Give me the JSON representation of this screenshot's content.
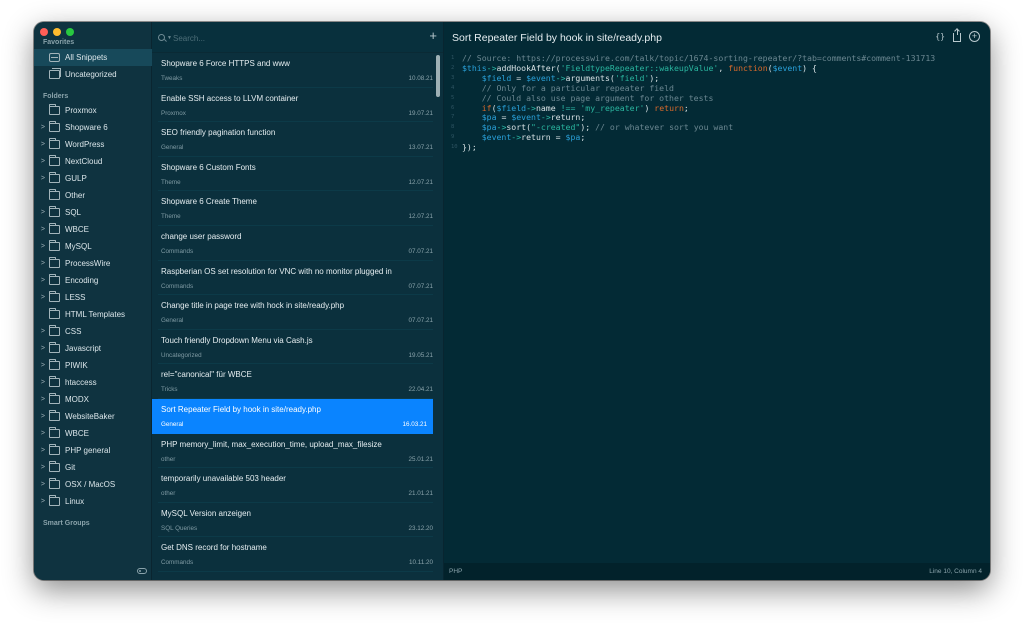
{
  "window": {
    "traffic_lights": [
      "close",
      "minimize",
      "zoom"
    ]
  },
  "sidebar": {
    "favorites_label": "Favorites",
    "favorites": [
      {
        "label": "All Snippets",
        "icon": "tray-icon",
        "selected": true
      },
      {
        "label": "Uncategorized",
        "icon": "stack-icon",
        "selected": false
      }
    ],
    "folders_label": "Folders",
    "folders": [
      {
        "label": "Proxmox",
        "expandable": false
      },
      {
        "label": "Shopware 6",
        "expandable": true
      },
      {
        "label": "WordPress",
        "expandable": true
      },
      {
        "label": "NextCloud",
        "expandable": true
      },
      {
        "label": "GULP",
        "expandable": true
      },
      {
        "label": "Other",
        "expandable": false
      },
      {
        "label": "SQL",
        "expandable": true
      },
      {
        "label": "WBCE",
        "expandable": true
      },
      {
        "label": "MySQL",
        "expandable": true
      },
      {
        "label": "ProcessWire",
        "expandable": true
      },
      {
        "label": "Encoding",
        "expandable": true
      },
      {
        "label": "LESS",
        "expandable": true
      },
      {
        "label": "HTML Templates",
        "expandable": false
      },
      {
        "label": "CSS",
        "expandable": true
      },
      {
        "label": "Javascript",
        "expandable": true
      },
      {
        "label": "PIWIK",
        "expandable": true
      },
      {
        "label": "htaccess",
        "expandable": true
      },
      {
        "label": "MODX",
        "expandable": true
      },
      {
        "label": "WebsiteBaker",
        "expandable": true
      },
      {
        "label": "WBCE",
        "expandable": true
      },
      {
        "label": "PHP general",
        "expandable": true
      },
      {
        "label": "Git",
        "expandable": true
      },
      {
        "label": "OSX / MacOS",
        "expandable": true
      },
      {
        "label": "Linux",
        "expandable": true
      }
    ],
    "smart_groups_label": "Smart Groups",
    "chevron_glyph": ">"
  },
  "list": {
    "search_placeholder": "Search...",
    "search_value": "",
    "add_glyph": "+",
    "items": [
      {
        "title": "Shopware 6 Force HTTPS and www",
        "category": "Tweaks",
        "date": "10.08.21"
      },
      {
        "title": "Enable SSH access to LLVM container",
        "category": "Proxmox",
        "date": "19.07.21"
      },
      {
        "title": "SEO friendly pagination function",
        "category": "General",
        "date": "13.07.21"
      },
      {
        "title": "Shopware 6 Custom Fonts",
        "category": "Theme",
        "date": "12.07.21"
      },
      {
        "title": "Shopware 6 Create Theme",
        "category": "Theme",
        "date": "12.07.21"
      },
      {
        "title": "change user password",
        "category": "Commands",
        "date": "07.07.21"
      },
      {
        "title": "Raspberian OS set resolution for VNC with no monitor plugged in",
        "category": "Commands",
        "date": "07.07.21"
      },
      {
        "title": "Change title in page tree with hock in site/ready.php",
        "category": "General",
        "date": "07.07.21"
      },
      {
        "title": "Touch friendly Dropdown Menu via Cash.js",
        "category": "Uncategorized",
        "date": "19.05.21"
      },
      {
        "title": "rel=\"canonical\" für WBCE",
        "category": "Tricks",
        "date": "22.04.21"
      },
      {
        "title": "Sort Repeater Field by hook in site/ready.php",
        "category": "General",
        "date": "16.03.21",
        "selected": true
      },
      {
        "title": "PHP memory_limit, max_execution_time, upload_max_filesize",
        "category": "other",
        "date": "25.01.21"
      },
      {
        "title": "temporarily unavailable 503 header",
        "category": "other",
        "date": "21.01.21"
      },
      {
        "title": "MySQL Version anzeigen",
        "category": "SQL Queries",
        "date": "23.12.20"
      },
      {
        "title": "Get DNS record for hostname",
        "category": "Commands",
        "date": "10.11.20"
      }
    ]
  },
  "editor": {
    "title": "Sort Repeater Field by hook in site/ready.php",
    "toolbar": {
      "braces": "{}",
      "add": "+"
    },
    "code_lines": [
      [
        {
          "t": "// Source: https://processwire.com/talk/topic/1674-sorting-repeater/?tab=comments#comment-131713",
          "c": "comment"
        }
      ],
      [
        {
          "t": "$this",
          "c": "var"
        },
        {
          "t": "->",
          "c": "op"
        },
        {
          "t": "addHookAfter(",
          "c": "plain"
        },
        {
          "t": "'FieldtypeRepeater::wakeupValue'",
          "c": "str"
        },
        {
          "t": ", ",
          "c": "plain"
        },
        {
          "t": "function",
          "c": "kw"
        },
        {
          "t": "(",
          "c": "plain"
        },
        {
          "t": "$event",
          "c": "var"
        },
        {
          "t": ") {",
          "c": "plain"
        }
      ],
      [
        {
          "t": "    ",
          "c": "plain"
        },
        {
          "t": "$field",
          "c": "var"
        },
        {
          "t": " = ",
          "c": "plain"
        },
        {
          "t": "$event",
          "c": "var"
        },
        {
          "t": "->",
          "c": "op"
        },
        {
          "t": "arguments(",
          "c": "plain"
        },
        {
          "t": "'field'",
          "c": "str"
        },
        {
          "t": ");",
          "c": "plain"
        }
      ],
      [
        {
          "t": "    // Only for a particular repeater field",
          "c": "comment"
        }
      ],
      [
        {
          "t": "    // Could also use page argument for other tests",
          "c": "comment"
        }
      ],
      [
        {
          "t": "    ",
          "c": "plain"
        },
        {
          "t": "if",
          "c": "kw"
        },
        {
          "t": "(",
          "c": "plain"
        },
        {
          "t": "$field",
          "c": "var"
        },
        {
          "t": "->",
          "c": "op"
        },
        {
          "t": "name ",
          "c": "plain"
        },
        {
          "t": "!==",
          "c": "op"
        },
        {
          "t": " ",
          "c": "plain"
        },
        {
          "t": "'my_repeater'",
          "c": "str"
        },
        {
          "t": ") ",
          "c": "plain"
        },
        {
          "t": "return",
          "c": "kw"
        },
        {
          "t": ";",
          "c": "plain"
        }
      ],
      [
        {
          "t": "    ",
          "c": "plain"
        },
        {
          "t": "$pa",
          "c": "var"
        },
        {
          "t": " = ",
          "c": "plain"
        },
        {
          "t": "$event",
          "c": "var"
        },
        {
          "t": "->",
          "c": "op"
        },
        {
          "t": "return;",
          "c": "plain"
        }
      ],
      [
        {
          "t": "    ",
          "c": "plain"
        },
        {
          "t": "$pa",
          "c": "var"
        },
        {
          "t": "->",
          "c": "op"
        },
        {
          "t": "sort(",
          "c": "plain"
        },
        {
          "t": "\"-created\"",
          "c": "str"
        },
        {
          "t": "); ",
          "c": "plain"
        },
        {
          "t": "// or whatever sort you want",
          "c": "comment"
        }
      ],
      [
        {
          "t": "    ",
          "c": "plain"
        },
        {
          "t": "$event",
          "c": "var"
        },
        {
          "t": "->",
          "c": "op"
        },
        {
          "t": "return = ",
          "c": "plain"
        },
        {
          "t": "$pa",
          "c": "var"
        },
        {
          "t": ";",
          "c": "plain"
        }
      ],
      [
        {
          "t": "});",
          "c": "plain"
        }
      ]
    ]
  },
  "statusbar": {
    "language": "PHP",
    "position": "Line 10, Column 4"
  },
  "colors": {
    "accent": "#0a84ff",
    "sidebar_bg": "#0f3340",
    "list_bg": "#0b303d",
    "editor_bg": "#032a35"
  }
}
